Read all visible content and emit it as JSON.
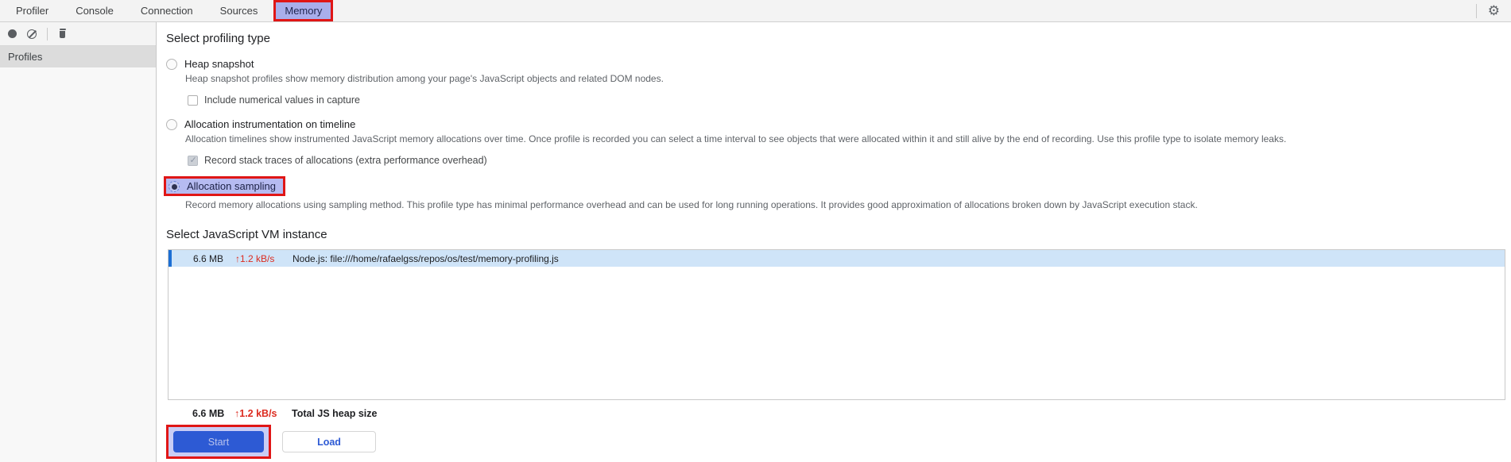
{
  "colors": {
    "accent_blue": "#2d5ad4",
    "highlight_red": "#e01616",
    "tab_highlight_lavender": "#a9aeeb",
    "selected_row_bg": "#cfe4f8",
    "selected_row_accent": "#1c6fd4",
    "stat_red": "#dc2c20"
  },
  "tab_bar": {
    "tabs": [
      "Profiler",
      "Console",
      "Connection",
      "Sources",
      "Memory"
    ],
    "active_tab": "Memory"
  },
  "toolbar": {
    "icons": [
      "record-icon",
      "clear-icon",
      "trash-icon"
    ]
  },
  "sidebar": {
    "items": [
      {
        "label": "Profiles",
        "selected": true
      }
    ]
  },
  "profiling": {
    "heading": "Select profiling type",
    "options": [
      {
        "label": "Heap snapshot",
        "description": "Heap snapshot profiles show memory distribution among your page's JavaScript objects and related DOM nodes.",
        "selected": false,
        "checkbox": {
          "label": "Include numerical values in capture",
          "checked": false
        }
      },
      {
        "label": "Allocation instrumentation on timeline",
        "description": "Allocation timelines show instrumented JavaScript memory allocations over time. Once profile is recorded you can select a time interval to see objects that were allocated within it and still alive by the end of recording. Use this profile type to isolate memory leaks.",
        "selected": false,
        "checkbox": {
          "label": "Record stack traces of allocations (extra performance overhead)",
          "checked": true,
          "disabled": true
        }
      },
      {
        "label": "Allocation sampling",
        "description": "Record memory allocations using sampling method. This profile type has minimal performance overhead and can be used for long running operations. It provides good approximation of allocations broken down by JavaScript execution stack.",
        "selected": true,
        "highlighted": true
      }
    ]
  },
  "vm_section": {
    "heading": "Select JavaScript VM instance",
    "instances": [
      {
        "size": "6.6 MB",
        "rate": "↑1.2 kB/s",
        "name": "Node.js: file:///home/rafaelgss/repos/os/test/memory-profiling.js",
        "selected": true
      }
    ],
    "total": {
      "size": "6.6 MB",
      "rate": "↑1.2 kB/s",
      "label": "Total JS heap size"
    }
  },
  "actions": {
    "start_label": "Start",
    "load_label": "Load"
  }
}
